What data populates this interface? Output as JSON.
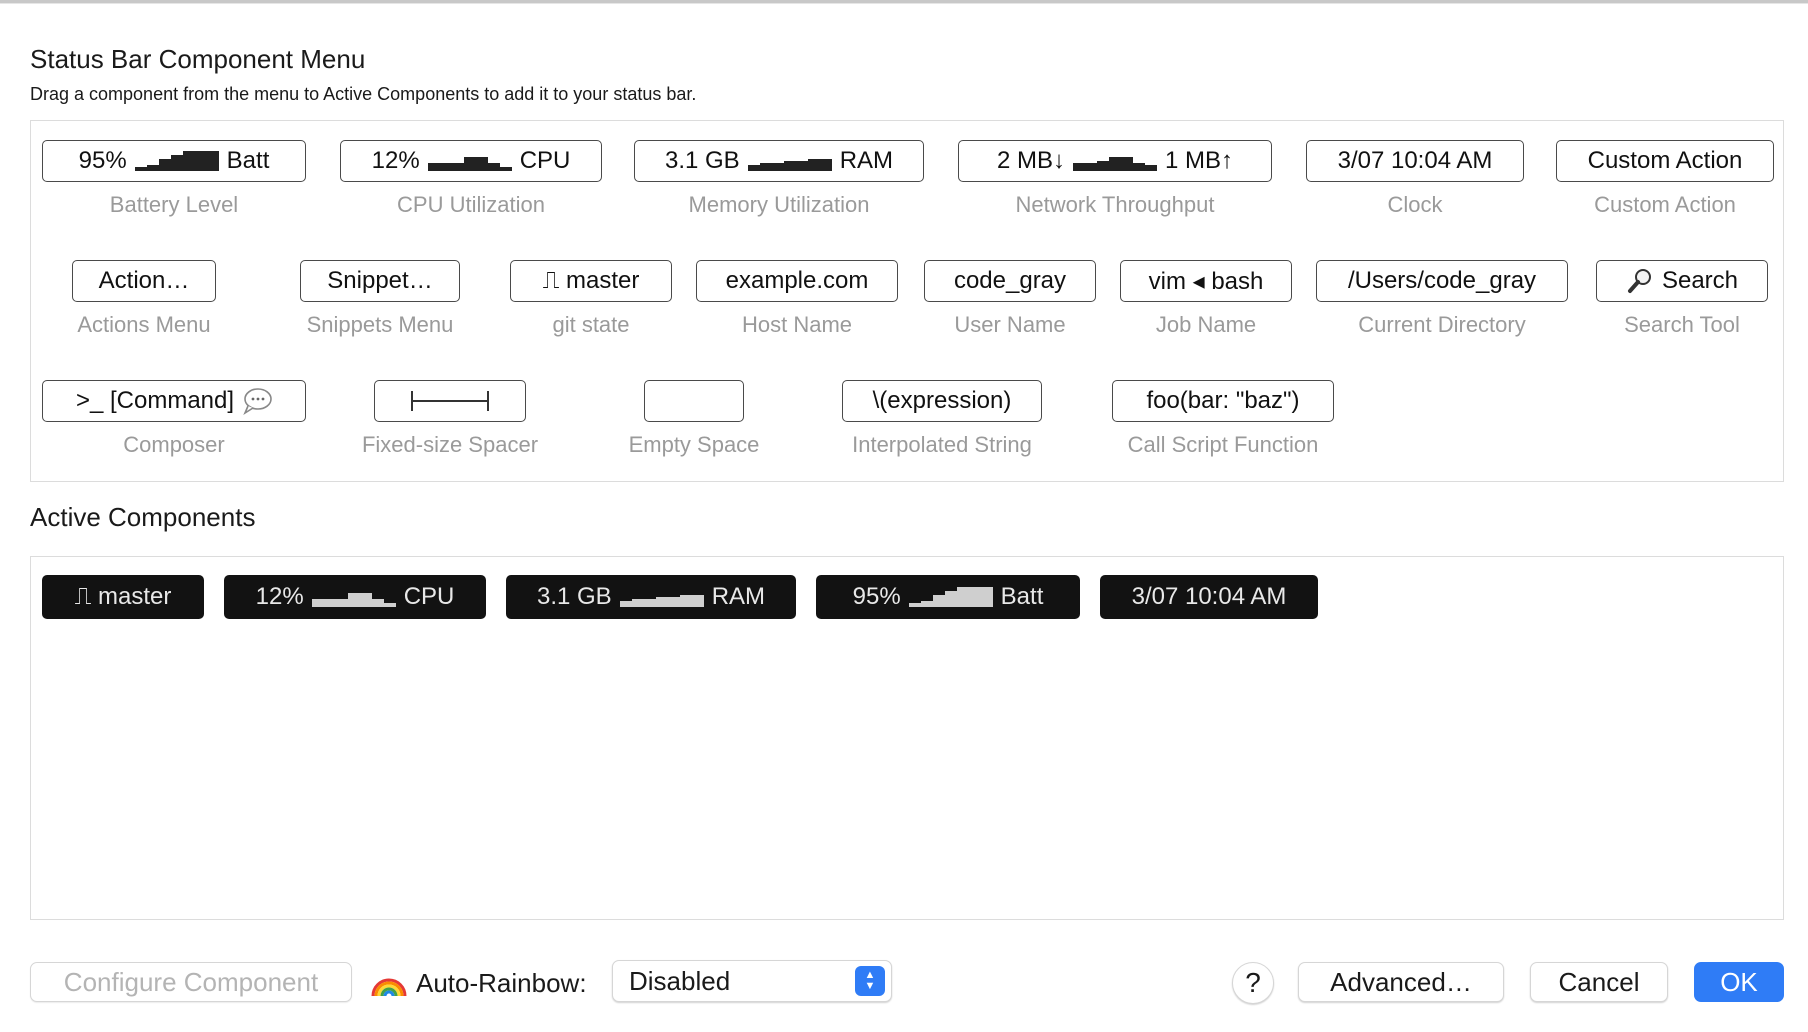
{
  "header": {
    "title": "Status Bar Component Menu",
    "subtitle": "Drag a component from the menu to Active Components to add it to your status bar."
  },
  "menu": {
    "row1": [
      {
        "chip_left": "95%",
        "chip_right": "Batt",
        "caption": "Battery Level"
      },
      {
        "chip_left": "12%",
        "chip_right": "CPU",
        "caption": "CPU Utilization"
      },
      {
        "chip_left": "3.1 GB",
        "chip_right": "RAM",
        "caption": "Memory Utilization"
      },
      {
        "chip_left": "2 MB↓",
        "chip_right": "1 MB↑",
        "caption": "Network Throughput"
      },
      {
        "chip": "3/07 10:04 AM",
        "caption": "Clock"
      },
      {
        "chip": "Custom Action",
        "caption": "Custom Action"
      }
    ],
    "row2": [
      {
        "chip": "Action…",
        "caption": "Actions Menu"
      },
      {
        "chip": "Snippet…",
        "caption": "Snippets Menu"
      },
      {
        "chip": "⎍ master",
        "caption": "git state"
      },
      {
        "chip": "example.com",
        "caption": "Host Name"
      },
      {
        "chip": "code_gray",
        "caption": "User Name"
      },
      {
        "chip": "vim ◂ bash",
        "caption": "Job Name"
      },
      {
        "chip": "/Users/code_gray",
        "caption": "Current Directory"
      },
      {
        "chip": "Search",
        "caption": "Search Tool"
      }
    ],
    "row3": [
      {
        "chip": ">_ [Command]",
        "caption": "Composer"
      },
      {
        "chip": "",
        "caption": "Fixed-size Spacer"
      },
      {
        "chip": "",
        "caption": "Empty Space"
      },
      {
        "chip": "\\(expression)",
        "caption": "Interpolated String"
      },
      {
        "chip": "foo(bar: \"baz\")",
        "caption": "Call Script Function"
      }
    ]
  },
  "active": {
    "title": "Active Components",
    "items": [
      {
        "left": "⎍ master",
        "right": ""
      },
      {
        "left": "12%",
        "right": "CPU"
      },
      {
        "left": "3.1 GB",
        "right": "RAM"
      },
      {
        "left": "95%",
        "right": "Batt"
      },
      {
        "left": "3/07 10:04 AM",
        "right": ""
      }
    ]
  },
  "footer": {
    "configure_label": "Configure Component",
    "rainbow_label": "Auto-Rainbow:",
    "rainbow_value": "Disabled",
    "help_label": "?",
    "advanced_label": "Advanced…",
    "cancel_label": "Cancel",
    "ok_label": "OK"
  },
  "icons": {
    "git": "git-branch-icon",
    "search": "magnifier-icon",
    "composer": "speech-bubble-icon",
    "rainbow": "rainbow-icon",
    "stepper": "updown-stepper-icon"
  },
  "colors": {
    "accent": "#2f7cf6",
    "active_chip_bg": "#121212",
    "caption": "#9a9a9a"
  }
}
